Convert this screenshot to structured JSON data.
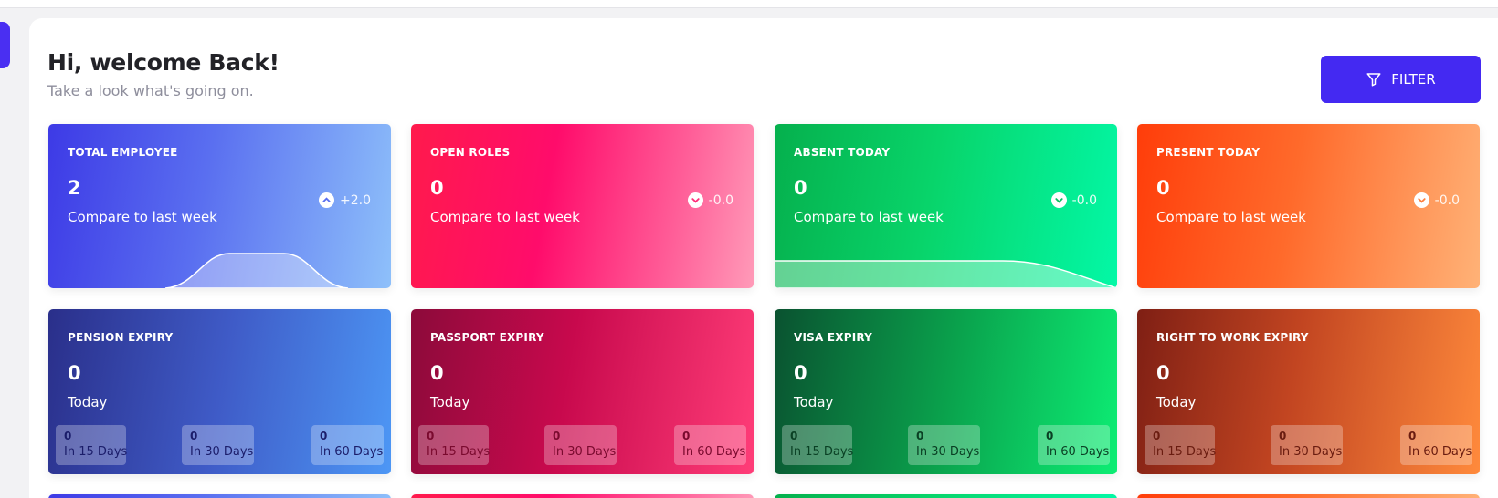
{
  "header": {
    "greeting": "Hi, welcome Back!",
    "subtitle": "Take a look what's going on.",
    "filter_label": "FILTER"
  },
  "stats": [
    {
      "title": "TOTAL EMPLOYEE",
      "value": "2",
      "sub": "Compare to last week",
      "delta": "+2.0",
      "direction": "up",
      "color": "#3d3ae6"
    },
    {
      "title": "OPEN ROLES",
      "value": "0",
      "sub": "Compare to last week",
      "delta": "-0.0",
      "direction": "down",
      "color": "#ff0c6b"
    },
    {
      "title": "ABSENT TODAY",
      "value": "0",
      "sub": "Compare to last week",
      "delta": "-0.0",
      "direction": "down",
      "color": "#08d46a"
    },
    {
      "title": "PRESENT TODAY",
      "value": "0",
      "sub": "Compare to last week",
      "delta": "-0.0",
      "direction": "down",
      "color": "#ff3d0a"
    }
  ],
  "expiries": [
    {
      "title": "PENSION EXPIRY",
      "value": "0",
      "sub": "Today",
      "d15": {
        "value": "0",
        "label": "In 15 Days"
      },
      "d30": {
        "value": "0",
        "label": "In 30 Days"
      },
      "d60": {
        "value": "0",
        "label": "In 60 Days"
      }
    },
    {
      "title": "PASSPORT EXPIRY",
      "value": "0",
      "sub": "Today",
      "d15": {
        "value": "0",
        "label": "In 15 Days"
      },
      "d30": {
        "value": "0",
        "label": "In 30 Days"
      },
      "d60": {
        "value": "0",
        "label": "In 60 Days"
      }
    },
    {
      "title": "VISA EXPIRY",
      "value": "0",
      "sub": "Today",
      "d15": {
        "value": "0",
        "label": "In 15 Days"
      },
      "d30": {
        "value": "0",
        "label": "In 30 Days"
      },
      "d60": {
        "value": "0",
        "label": "In 60 Days"
      }
    },
    {
      "title": "RIGHT TO WORK EXPIRY",
      "value": "0",
      "sub": "Today",
      "d15": {
        "value": "0",
        "label": "In 15 Days"
      },
      "d30": {
        "value": "0",
        "label": "In 30 Days"
      },
      "d60": {
        "value": "0",
        "label": "In 60 Days"
      }
    }
  ],
  "icons": {
    "filter": "filter-icon",
    "up": "chevron-up-circle-icon",
    "down": "chevron-down-circle-icon"
  }
}
